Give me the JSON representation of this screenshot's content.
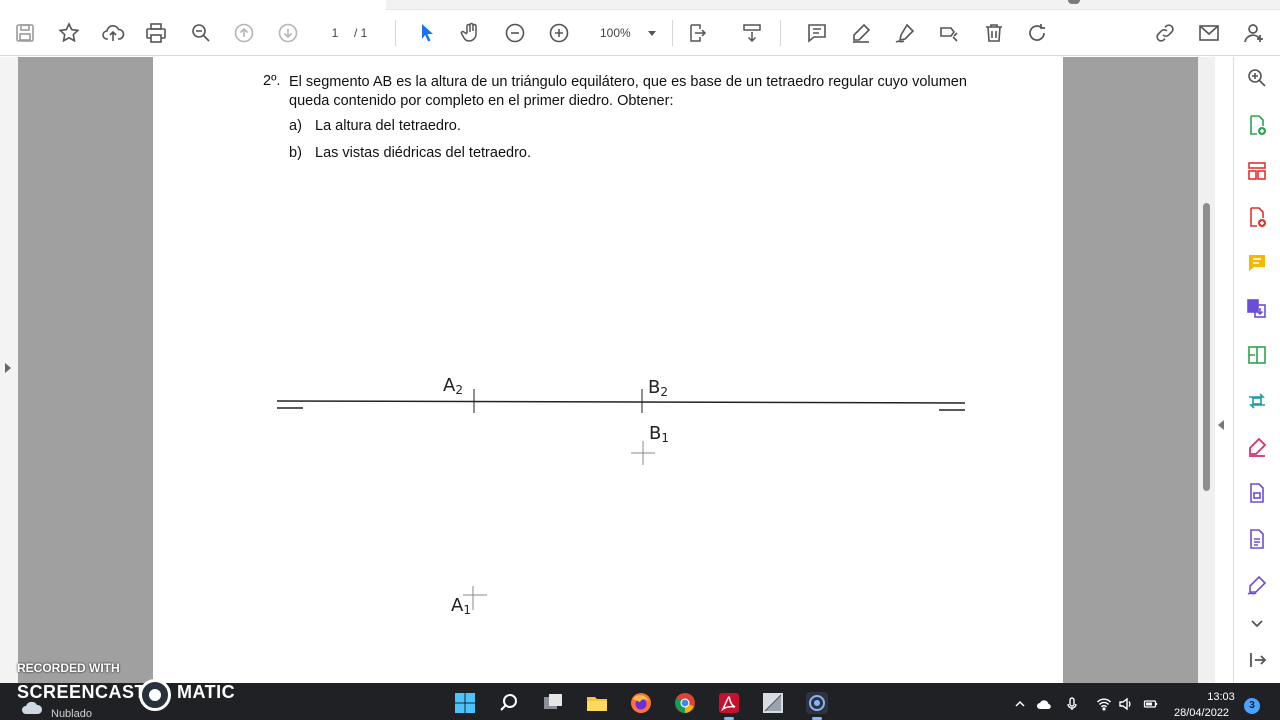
{
  "toolbar": {
    "icons": [
      "save-icon",
      "bookmark-star-icon",
      "upload-cloud-icon",
      "print-icon",
      "zoom-search-icon",
      "page-up-icon",
      "page-down-icon",
      "select-arrow-icon",
      "hand-pan-icon",
      "zoom-out-icon",
      "zoom-in-icon",
      "fit-page-icon",
      "scroll-mode-icon",
      "comment-icon",
      "highlight-pen-icon",
      "sign-icon",
      "redact-icon",
      "delete-icon",
      "rotate-icon",
      "share-link-icon",
      "email-icon",
      "account-icon"
    ],
    "current_page": "1",
    "total_pages": "/ 1",
    "zoom": "100%",
    "accent": "#1a73e8"
  },
  "document": {
    "question_number": "2º.",
    "question_text": "El segmento AB es la altura de un triángulo equilátero, que es base de un tetraedro regular cuyo volumen queda contenido por completo en el primer diedro. Obtener:",
    "options": [
      {
        "letter": "a)",
        "text": "La altura del tetraedro."
      },
      {
        "letter": "b)",
        "text": "Las vistas diédricas del tetraedro."
      }
    ],
    "drawing": {
      "a2": {
        "base": "A",
        "sub": "2"
      },
      "b2": {
        "base": "B",
        "sub": "2"
      },
      "b1": {
        "base": "B",
        "sub": "1"
      },
      "a1": {
        "base": "A",
        "sub": "1"
      }
    }
  },
  "right_rail": {
    "icons": [
      "zoom-search-icon",
      "export-pdf-icon",
      "organize-pages-icon",
      "create-pdf-icon",
      "comment-icon",
      "combine-files-icon",
      "edit-pdf-icon",
      "convert-icon",
      "fill-sign-icon",
      "protect-icon",
      "pdf-file-icon",
      "more-tools-icon",
      "expand-icon",
      "collapse-rail-icon"
    ],
    "colors": {
      "red": "#e0332c",
      "yellow": "#f5b800",
      "green": "#2da44e",
      "purple": "#6a4fd6",
      "teal": "#1b9aa8",
      "pink": "#d6336c"
    }
  },
  "watermark": {
    "line1": "RECORDED WITH",
    "brand_left": "SCREENCAST",
    "brand_right": "MATIC"
  },
  "taskbar": {
    "weather_status": "Nublado",
    "apps": [
      "windows-start-icon",
      "search-icon",
      "task-view-icon",
      "file-explorer-icon",
      "firefox-icon",
      "chrome-icon",
      "acrobat-icon",
      "geometry-app-icon",
      "screencast-app-icon"
    ],
    "tray": [
      "chevron-up-icon",
      "cloud-icon",
      "microphone-icon",
      "wifi-icon",
      "speaker-icon",
      "battery-icon"
    ],
    "time": "13:03",
    "date": "28/04/2022",
    "notification_count": "3"
  }
}
